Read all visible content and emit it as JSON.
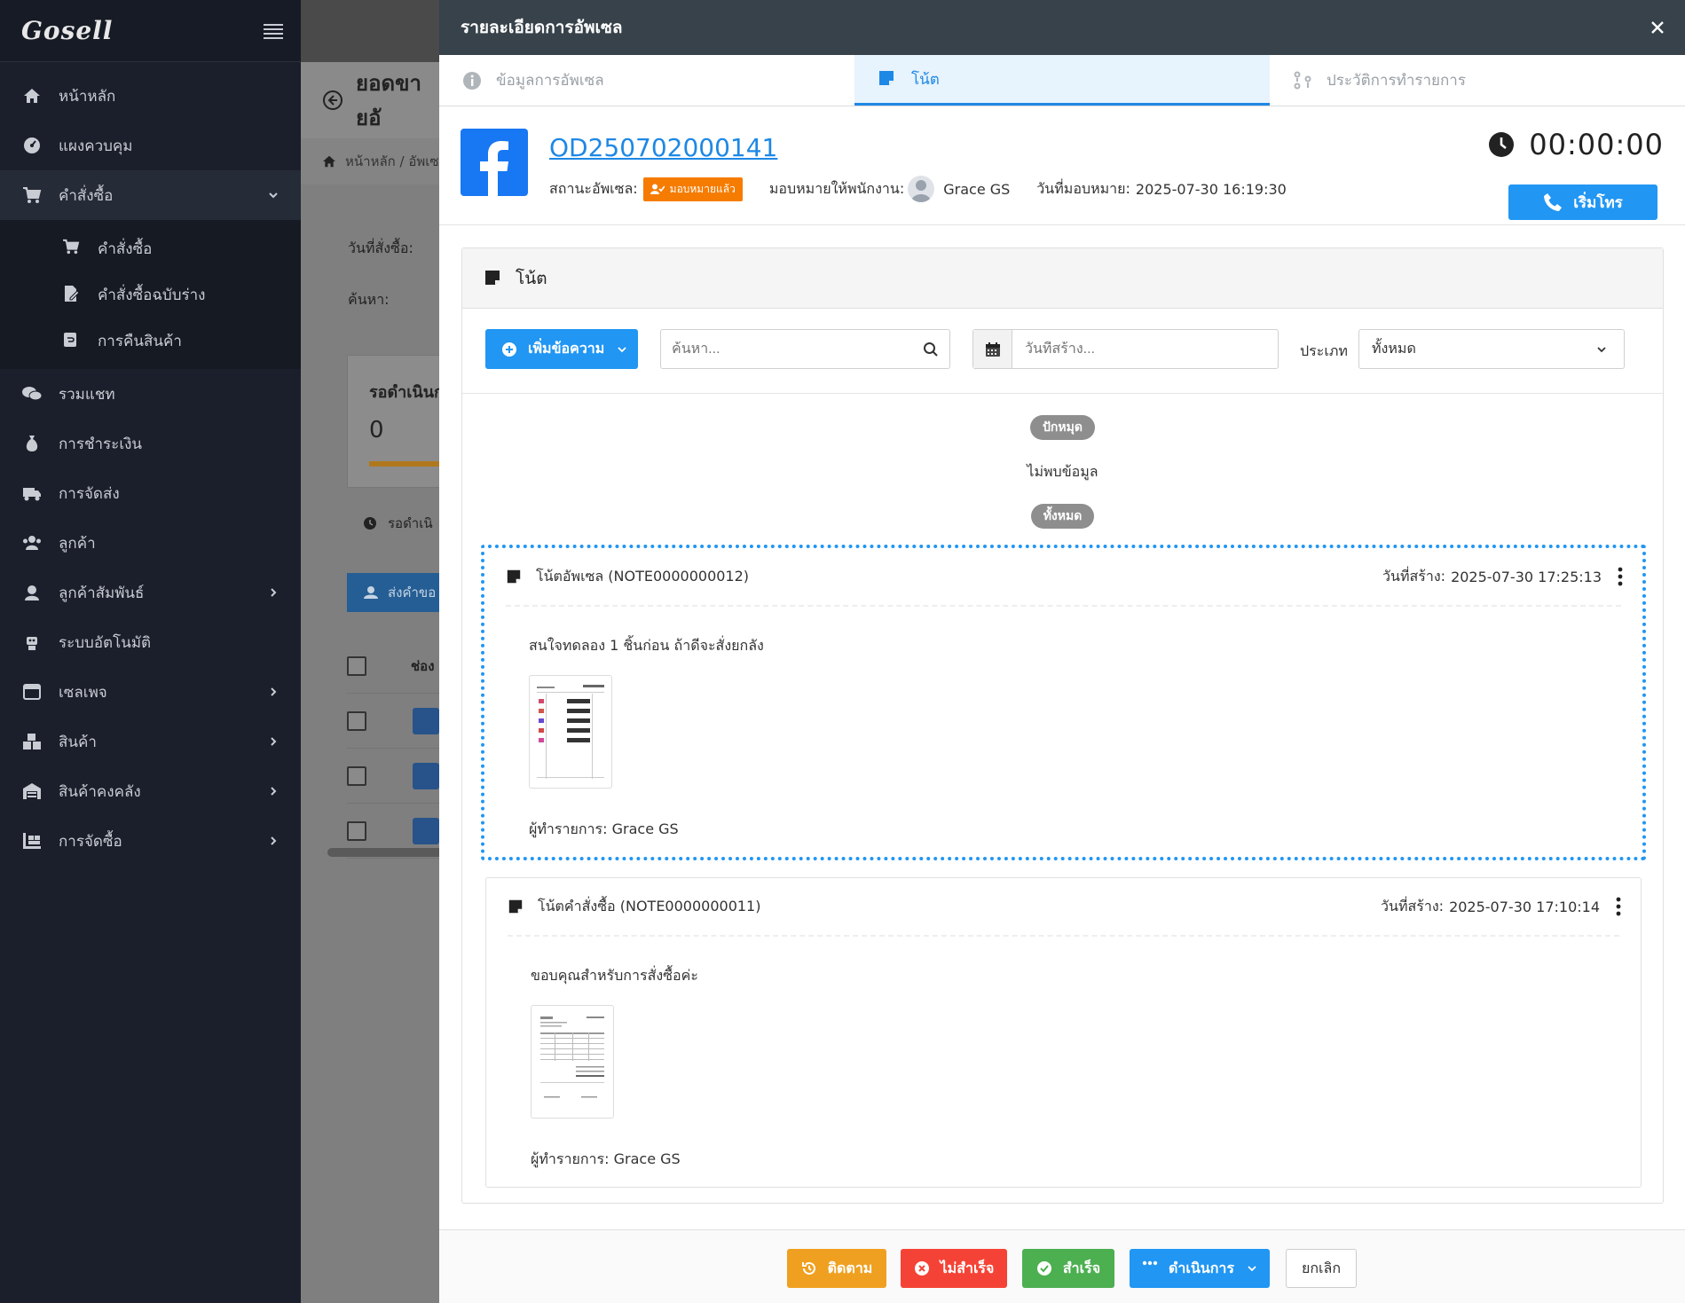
{
  "app": {
    "logo": "Gosell"
  },
  "sidebar": {
    "items": [
      {
        "label": "หน้าหลัก",
        "icon": "home-icon"
      },
      {
        "label": "แผงควบคุม",
        "icon": "dashboard-icon"
      },
      {
        "label": "คำสั่งซื้อ",
        "icon": "cart-icon",
        "expanded": true,
        "children": [
          {
            "label": "คำสั่งซื้อ",
            "icon": "cart-icon"
          },
          {
            "label": "คำสั่งซื้อฉบับร่าง",
            "icon": "draft-icon"
          },
          {
            "label": "การคืนสินค้า",
            "icon": "return-icon"
          }
        ]
      },
      {
        "label": "รวมแชท",
        "icon": "chat-icon"
      },
      {
        "label": "การชำระเงิน",
        "icon": "money-bag-icon"
      },
      {
        "label": "การจัดส่ง",
        "icon": "truck-icon"
      },
      {
        "label": "ลูกค้า",
        "icon": "users-icon"
      },
      {
        "label": "ลูกค้าสัมพันธ์",
        "icon": "crm-icon"
      },
      {
        "label": "ระบบอัตโนมัติ",
        "icon": "robot-icon"
      },
      {
        "label": "เซลเพจ",
        "icon": "browser-icon"
      },
      {
        "label": "สินค้า",
        "icon": "boxes-icon"
      },
      {
        "label": "สินค้าคงคลัง",
        "icon": "warehouse-icon"
      },
      {
        "label": "การจัดซื้อ",
        "icon": "purchase-icon"
      }
    ]
  },
  "background_page": {
    "title": "ยอดขายอั",
    "breadcrumb": "หน้าหลัก / อัพเซ",
    "filter_date_label": "วันที่สั่งซื้อ:",
    "filter_search_label": "ค้นหา:",
    "stat_label": "รอดำเนินก",
    "stat_value": "0",
    "tab_label": "รอดำเนิ",
    "action_button": "ส่งคำขอ",
    "table_header": "ช่อง"
  },
  "drawer": {
    "title": "รายละเอียดการอัพเซล",
    "tabs": [
      {
        "label": "ข้อมูลการอัพเซล",
        "icon": "info-icon",
        "active": false
      },
      {
        "label": "โน้ต",
        "icon": "note-icon",
        "active": true
      },
      {
        "label": "ประวัติการทำรายการ",
        "icon": "history-icon",
        "active": false
      }
    ],
    "order": {
      "id": "OD250702000141",
      "status_label": "สถานะอัพเซล:",
      "status_badge": "มอบหมายแล้ว",
      "assigned_label": "มอบหมายให้พนักงาน:",
      "assignee": "Grace GS",
      "assigned_date_label": "วันที่มอบหมาย:",
      "assigned_date": "2025-07-30 16:19:30",
      "timer": "00:00:00",
      "call_button": "เริ่มโทร"
    },
    "notes_panel": {
      "title": "โน้ต",
      "add_button": "เพิ่มข้อความ",
      "search_placeholder": "ค้นหา...",
      "date_placeholder": "วันที่สร้าง...",
      "type_label": "ประเภท",
      "type_value": "ทั้งหมด",
      "pinned_label": "ปักหมุด",
      "no_data": "ไม่พบข้อมูล",
      "all_label": "ทั้งหมด",
      "notes": [
        {
          "title": "โน้ตอัพเซล (NOTE0000000012)",
          "created_label": "วันที่สร้าง:",
          "created": "2025-07-30 17:25:13",
          "text": "สนใจทดลอง 1 ชิ้นก่อน ถ้าดีจะสั่งยกลัง",
          "author_label": "ผู้ทำรายการ:",
          "author": "Grace GS",
          "selected": true
        },
        {
          "title": "โน้ตคำสั่งซื้อ (NOTE0000000011)",
          "created_label": "วันที่สร้าง:",
          "created": "2025-07-30 17:10:14",
          "text": "ขอบคุณสำหรับการสั่งซื้อค่ะ",
          "author_label": "ผู้ทำรายการ:",
          "author": "Grace GS",
          "selected": false
        }
      ]
    },
    "footer": {
      "follow": "ติดตาม",
      "fail": "ไม่สำเร็จ",
      "success": "สำเร็จ",
      "actions": "ดำเนินการ",
      "cancel": "ยกเลิก"
    }
  },
  "colors": {
    "primary": "#2196f3",
    "sidebar_bg": "#1b1f2b",
    "drawer_header": "#37424a",
    "badge_orange": "#f57c00",
    "follow": "#f0a020",
    "fail": "#f44336",
    "success": "#4caf50"
  }
}
